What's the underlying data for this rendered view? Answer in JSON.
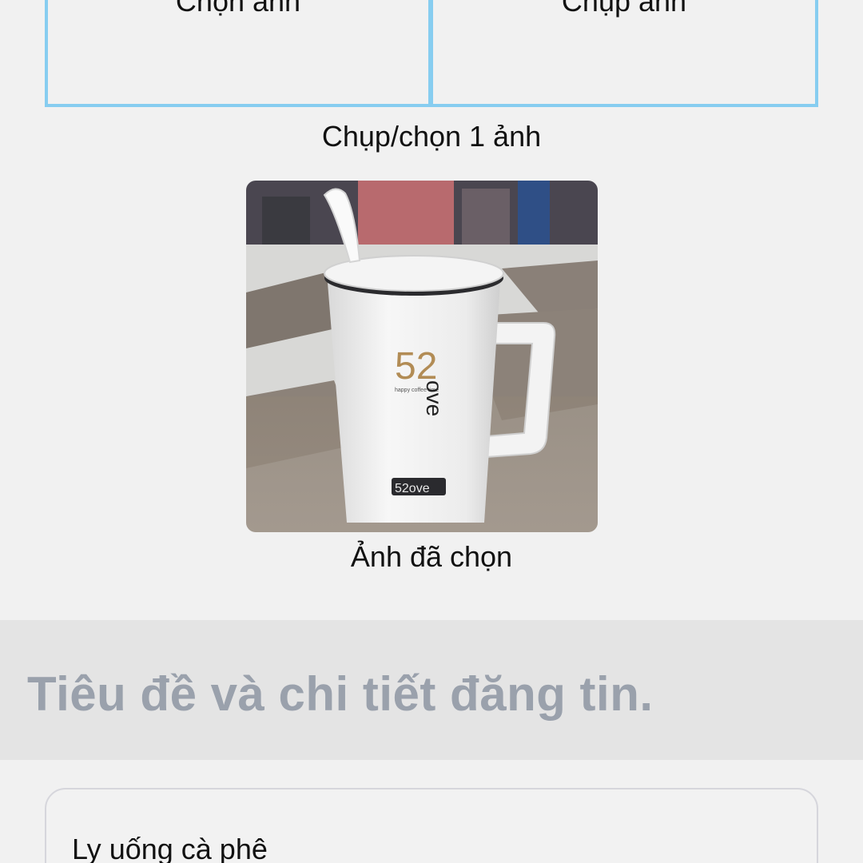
{
  "picker": {
    "choose_label": "Chọn ảnh",
    "capture_label": "Chụp ảnh",
    "hint": "Chụp/chọn 1 ảnh"
  },
  "preview": {
    "caption": "Ảnh đã chọn",
    "mug_text_big": "52",
    "mug_text_vertical": "ove",
    "mug_text_small": "happy coffee time",
    "mug_badge": "52ove"
  },
  "section": {
    "title": "Tiêu đề và chi tiết đăng tin."
  },
  "form": {
    "title_value": "Ly uống cà phê"
  },
  "colors": {
    "accent_border": "#87cdf0",
    "section_bg": "#e4e4e4",
    "section_text": "#9aa1ac"
  }
}
